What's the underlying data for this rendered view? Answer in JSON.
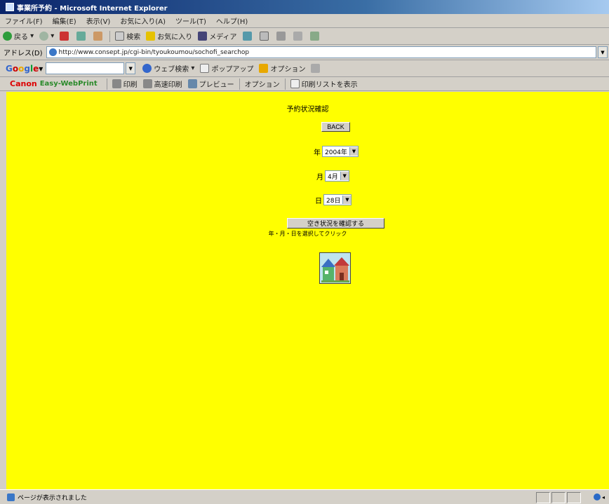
{
  "window": {
    "title": "事業所予約 - Microsoft Internet Explorer"
  },
  "menu": [
    "ファイル(F)",
    "編集(E)",
    "表示(V)",
    "お気に入り(A)",
    "ツール(T)",
    "ヘルプ(H)"
  ],
  "toolbar": {
    "back": "戻る",
    "search": "検索",
    "favorites": "お気に入り",
    "media": "メディア"
  },
  "address": {
    "label": "アドレス(D)",
    "url": "http://www.consept.jp/cgi-bin/tyoukoumou/sochofi_searchop"
  },
  "google": {
    "web_search": "ウェブ検索",
    "popup_block": "ポップアップ",
    "options": "オプション"
  },
  "canon": {
    "logo": "Canon",
    "product": "Easy-WebPrint",
    "print": "印刷",
    "preview_print": "高速印刷",
    "preview": "プレビュー",
    "option": "オプション",
    "show_print_list": "印刷リストを表示"
  },
  "page": {
    "heading": "予約状況確認",
    "back_button": "BACK",
    "year_label": "年",
    "year_value": "2004年",
    "month_label": "月",
    "month_value": "4月",
    "day_label": "日",
    "day_value": "28日",
    "confirm_button": "空き状況を確認する",
    "instruction": "年・月・日を選択してクリック"
  },
  "status": {
    "text": "ページが表示されました"
  }
}
